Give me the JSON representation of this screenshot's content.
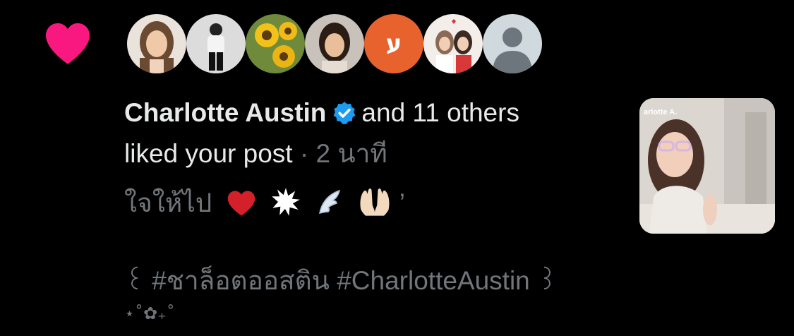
{
  "notification": {
    "type_icon": "heart-icon",
    "avatars": [
      {
        "icon": "avatar-photo-woman"
      },
      {
        "icon": "avatar-photo-person-standing"
      },
      {
        "icon": "avatar-photo-sunflowers"
      },
      {
        "icon": "avatar-photo-girl"
      },
      {
        "letter": "ע",
        "color": "#e8622e"
      },
      {
        "icon": "avatar-photo-two-women"
      },
      {
        "icon": "avatar-default-person"
      }
    ],
    "actor_name": "Charlotte Austin",
    "verified_icon": "verified-badge-icon",
    "others_text": "and 11 others",
    "action_text": "liked your post",
    "time_text": "· 2 นาที",
    "post_text": "ใจให้ไป",
    "post_emojis": [
      "red-heart-emoji",
      "anger-symbol-emoji",
      "wing-emoji",
      "palms-up-emoji"
    ],
    "post_tail": "’",
    "hashtag_line": {
      "left_bracket": "꒰",
      "hashtag_thai": "#ชาล็อตออสติน",
      "hashtag_en": "#CharlotteAustin",
      "right_bracket": "꒱"
    },
    "decor_line": "⋆˚✿₊˚",
    "media_thumbnail": {
      "label": "arlotte A.",
      "icon": "post-media-thumbnail"
    }
  },
  "colors": {
    "background": "#000000",
    "heart": "#f91880",
    "primary_text": "#e7e9ea",
    "secondary_text": "#71767b",
    "verified": "#1d9bf0"
  }
}
